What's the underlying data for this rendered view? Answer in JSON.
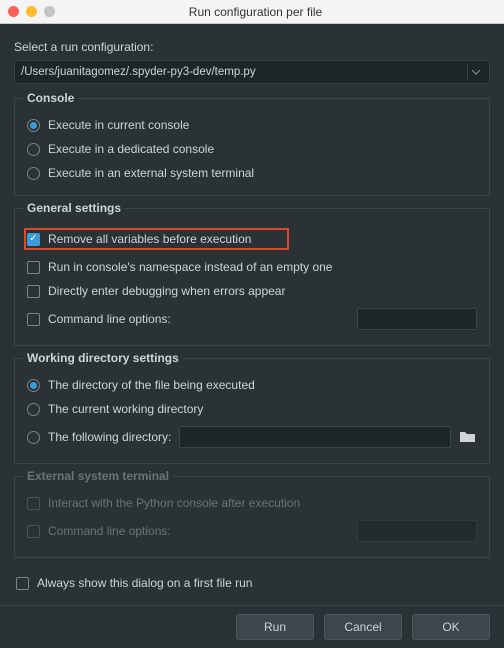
{
  "window": {
    "title": "Run configuration per file"
  },
  "select": {
    "label": "Select a run configuration:",
    "value": "/Users/juanitagomez/.spyder-py3-dev/temp.py"
  },
  "console": {
    "title": "Console",
    "opt_current": "Execute in current console",
    "opt_dedicated": "Execute in a dedicated console",
    "opt_external": "Execute in an external system terminal"
  },
  "general": {
    "title": "General settings",
    "remove_vars": "Remove all variables before execution",
    "namespace": "Run in console's namespace instead of an empty one",
    "debug_errors": "Directly enter debugging when errors appear",
    "cmdline": "Command line options:"
  },
  "workdir": {
    "title": "Working directory settings",
    "file_dir": "The directory of the file being executed",
    "cwd": "The current working directory",
    "following": "The following directory:"
  },
  "external": {
    "title": "External system terminal",
    "interact": "Interact with the Python console after execution",
    "cmdline": "Command line options:"
  },
  "always_show": "Always show this dialog on a first file run",
  "buttons": {
    "run": "Run",
    "cancel": "Cancel",
    "ok": "OK"
  }
}
